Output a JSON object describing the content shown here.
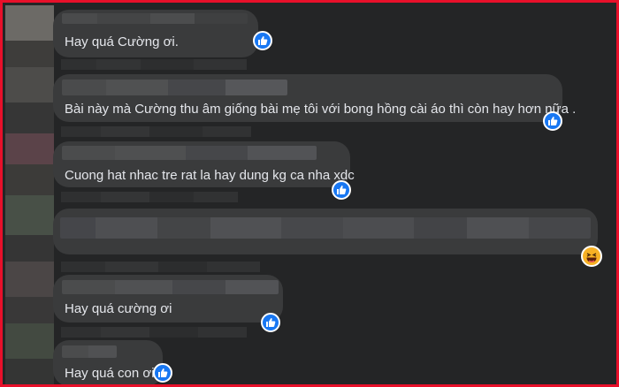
{
  "comments": [
    {
      "text": "Hay quá Cường ơi.",
      "reaction": "like-icon"
    },
    {
      "text": "Bài này mà Cường thu âm giống bài mẹ tôi với bong hồng cài áo thì còn hay hơn nữa .",
      "reaction": "like-icon"
    },
    {
      "text": "Cuong hat nhac tre rat la hay dung kg ca nha xdc",
      "reaction": "like-icon"
    },
    {
      "text": "",
      "reaction": "haha-icon"
    },
    {
      "text": "Hay quá cường ơi",
      "reaction": "like-icon"
    },
    {
      "text": "Hay quá con ơi",
      "reaction": "like-icon"
    }
  ],
  "colors": {
    "frame_border": "#e8102a",
    "background": "#242526",
    "bubble": "#3a3b3c",
    "text": "#e4e6eb",
    "like_badge": "#1877f2",
    "haha_badge": "#f7b125"
  }
}
